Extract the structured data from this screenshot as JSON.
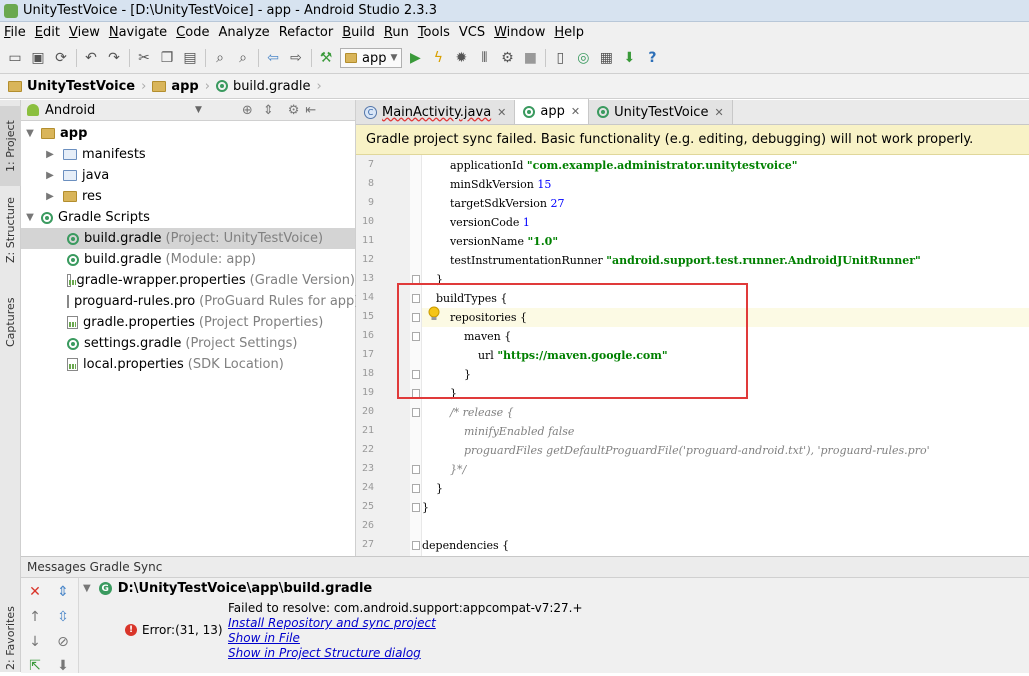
{
  "window": {
    "title": "UnityTestVoice - [D:\\UnityTestVoice] - app - Android Studio 2.3.3"
  },
  "menu": [
    {
      "u": "F",
      "rest": "ile"
    },
    {
      "u": "E",
      "rest": "dit"
    },
    {
      "u": "V",
      "rest": "iew"
    },
    {
      "u": "N",
      "rest": "avigate"
    },
    {
      "u": "C",
      "rest": "ode"
    },
    {
      "u": "",
      "rest": "Analyze"
    },
    {
      "u": "",
      "rest": "Refactor"
    },
    {
      "u": "B",
      "rest": "uild"
    },
    {
      "u": "R",
      "rest": "un"
    },
    {
      "u": "T",
      "rest": "ools"
    },
    {
      "u": "",
      "rest": "VCS"
    },
    {
      "u": "W",
      "rest": "indow"
    },
    {
      "u": "H",
      "rest": "elp"
    }
  ],
  "toolbar": {
    "run_config": "app",
    "help_glyph": "?"
  },
  "breadcrumb": [
    "UnityTestVoice",
    "app",
    "build.gradle"
  ],
  "side_tabs": {
    "project": "1: Project",
    "structure": "Z: Structure",
    "captures": "Captures",
    "favorites": "2: Favorites"
  },
  "project": {
    "view_mode": "Android",
    "tree": {
      "app": "app",
      "manifests": "manifests",
      "java": "java",
      "res": "res",
      "gradle_scripts": "Gradle Scripts",
      "files": [
        {
          "name": "build.gradle",
          "hint": "(Project: UnityTestVoice)"
        },
        {
          "name": "build.gradle",
          "hint": "(Module: app)"
        },
        {
          "name": "gradle-wrapper.properties",
          "hint": "(Gradle Version)"
        },
        {
          "name": "proguard-rules.pro",
          "hint": "(ProGuard Rules for app)"
        },
        {
          "name": "gradle.properties",
          "hint": "(Project Properties)"
        },
        {
          "name": "settings.gradle",
          "hint": "(Project Settings)"
        },
        {
          "name": "local.properties",
          "hint": "(SDK Location)"
        }
      ]
    }
  },
  "editor": {
    "tabs": [
      {
        "label": "MainActivity.java"
      },
      {
        "label": "app"
      },
      {
        "label": "UnityTestVoice"
      }
    ],
    "banner": "Gradle project sync failed. Basic functionality (e.g. editing, debugging) will not work properly.",
    "lines": [
      {
        "n": "7",
        "a": "        applicationId ",
        "s": "\"com.example.administrator.unitytestvoice\"",
        "b": ""
      },
      {
        "n": "8",
        "a": "        minSdkVersion ",
        "num": "15"
      },
      {
        "n": "9",
        "a": "        targetSdkVersion ",
        "num": "27"
      },
      {
        "n": "10",
        "a": "        versionCode ",
        "num": "1"
      },
      {
        "n": "11",
        "a": "        versionName ",
        "s": "\"1.0\""
      },
      {
        "n": "12",
        "a": "        testInstrumentationRunner ",
        "s": "\"android.support.test.runner.AndroidJUnitRunner\""
      },
      {
        "n": "13",
        "a": "    }"
      },
      {
        "n": "14",
        "a": "    buildTypes {"
      },
      {
        "n": "15",
        "a": "        repositories {"
      },
      {
        "n": "16",
        "a": "            maven {"
      },
      {
        "n": "17",
        "a": "                url ",
        "s": "\"https://maven.google.com\""
      },
      {
        "n": "18",
        "a": "            }"
      },
      {
        "n": "19",
        "a": "        }"
      },
      {
        "n": "20",
        "c": "        /* release {"
      },
      {
        "n": "21",
        "c": "            minifyEnabled false"
      },
      {
        "n": "22",
        "c": "            proguardFiles getDefaultProguardFile('proguard-android.txt'), 'proguard-rules.pro'"
      },
      {
        "n": "23",
        "c": "        }*/"
      },
      {
        "n": "24",
        "a": "    }"
      },
      {
        "n": "25",
        "a": "}"
      },
      {
        "n": "26",
        "a": ""
      },
      {
        "n": "27",
        "a": "dependencies {"
      }
    ]
  },
  "messages": {
    "title": "Messages Gradle Sync",
    "file": "D:\\UnityTestVoice\\app\\build.gradle",
    "error_loc": "Error:(31, 13)",
    "error_text": "Failed to resolve: com.android.support:appcompat-v7:27.+",
    "links": [
      "Install Repository and sync project",
      "Show in File",
      "Show in Project Structure dialog"
    ]
  }
}
